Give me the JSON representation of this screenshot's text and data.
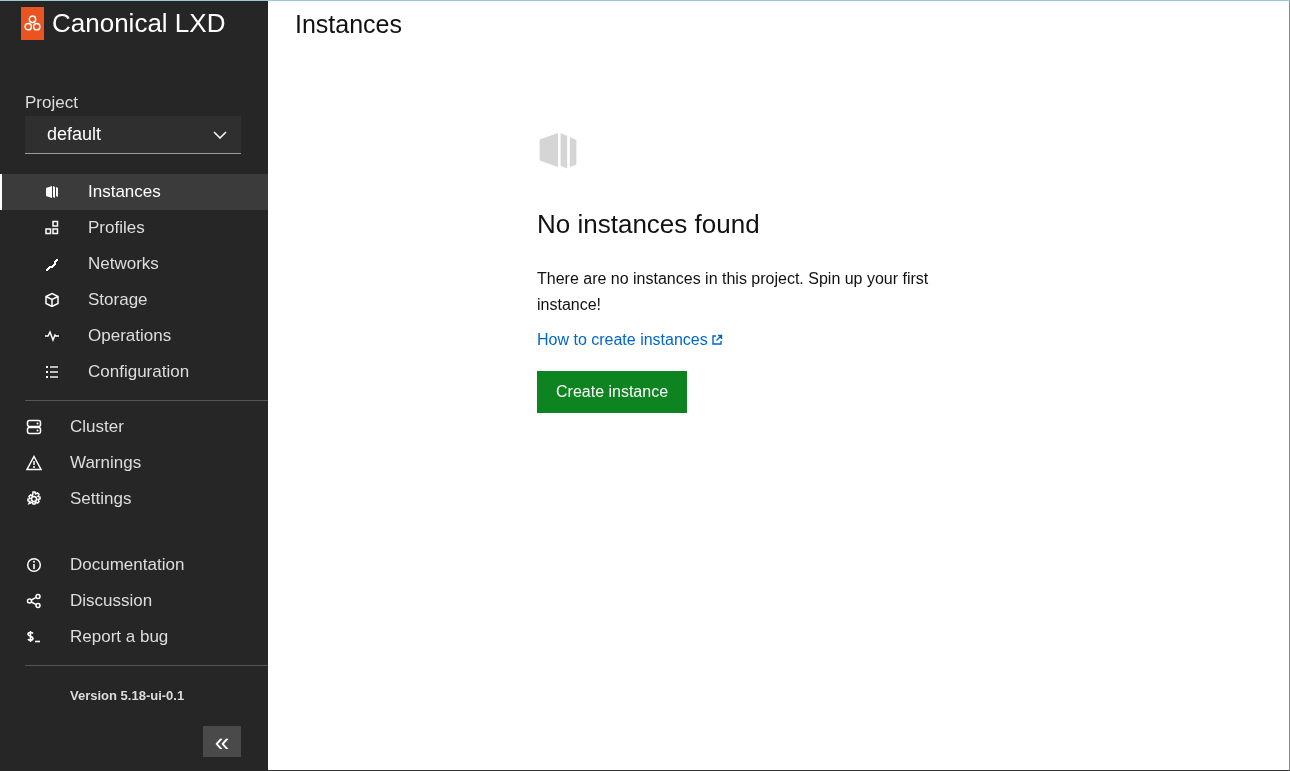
{
  "sidebar": {
    "logo": {
      "title": "Canonical LXD"
    },
    "project": {
      "label": "Project",
      "value": "default"
    },
    "project_items": [
      {
        "label": "Instances",
        "selected": true
      },
      {
        "label": "Profiles",
        "selected": false
      },
      {
        "label": "Networks",
        "selected": false
      },
      {
        "label": "Storage",
        "selected": false
      },
      {
        "label": "Operations",
        "selected": false
      },
      {
        "label": "Configuration",
        "selected": false
      }
    ],
    "global_items": [
      {
        "label": "Cluster",
        "selected": false
      },
      {
        "label": "Warnings",
        "selected": false
      },
      {
        "label": "Settings",
        "selected": false
      }
    ],
    "help_items": [
      {
        "label": "Documentation"
      },
      {
        "label": "Discussion"
      },
      {
        "label": "Report a bug"
      }
    ],
    "version": "Version 5.18-ui-0.1",
    "collapse_button": "«"
  },
  "main": {
    "title": "Instances",
    "empty_state": {
      "heading": "No instances found",
      "message": "There are no instances in this project. Spin up your first instance!",
      "link": "How to create instances",
      "button": "Create instance"
    }
  }
}
